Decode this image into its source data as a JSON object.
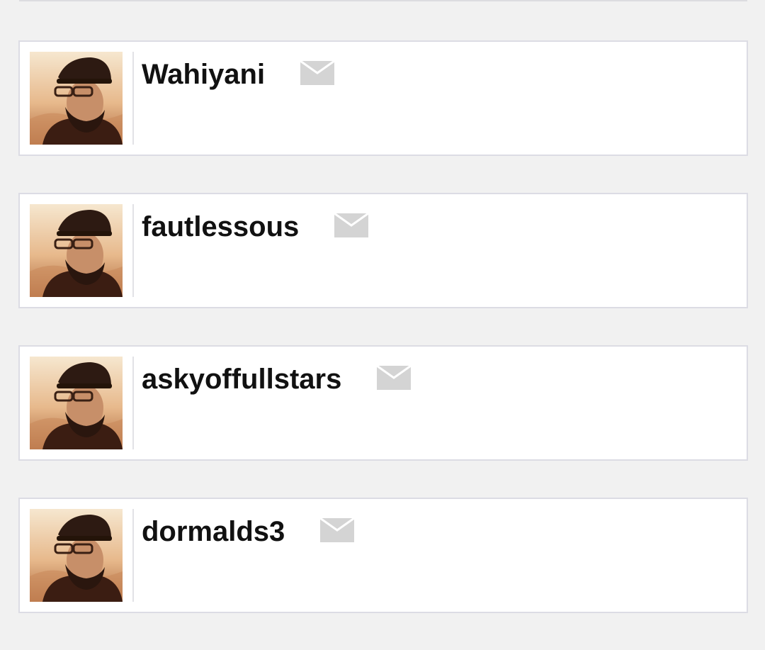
{
  "users": [
    {
      "username": "Wahiyani",
      "avatar_icon": "user-avatar",
      "message_icon": "envelope-icon"
    },
    {
      "username": "fautlessous",
      "avatar_icon": "user-avatar",
      "message_icon": "envelope-icon"
    },
    {
      "username": "askyoffullstars",
      "avatar_icon": "user-avatar",
      "message_icon": "envelope-icon"
    },
    {
      "username": "dormalds3",
      "avatar_icon": "user-avatar",
      "message_icon": "envelope-icon"
    }
  ],
  "colors": {
    "page_background": "#f1f1f1",
    "card_background": "#ffffff",
    "card_border": "#dcdce4",
    "username_text": "#111111",
    "mail_icon": "#d4d4d4"
  }
}
